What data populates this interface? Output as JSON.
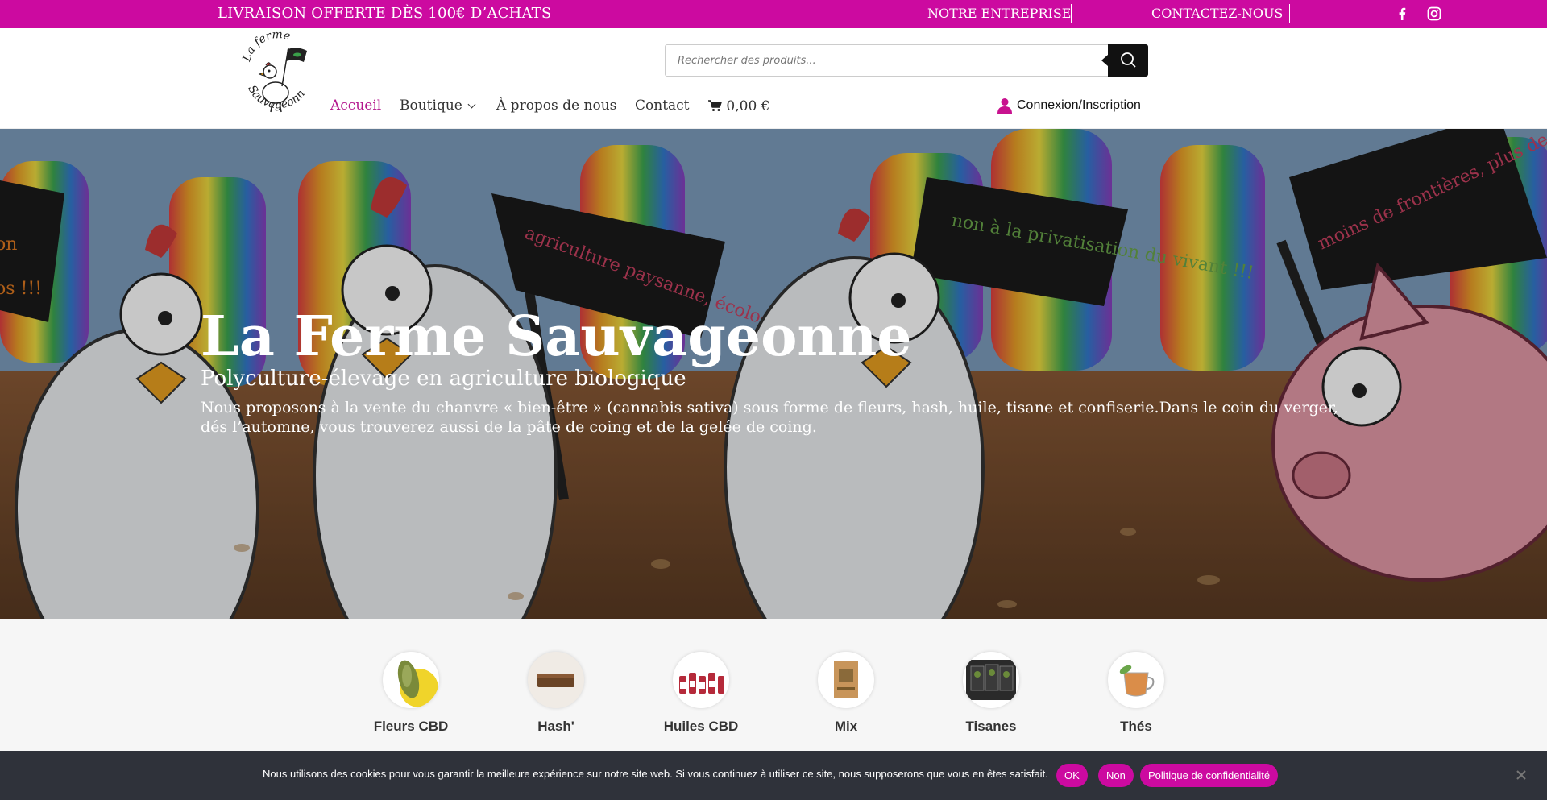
{
  "topbar": {
    "promo": "LIVRAISON OFFERTE DÈS 100€ D’ACHATS",
    "links": [
      "NOTRE ENTREPRISE",
      "CONTACTEZ-NOUS"
    ],
    "social_icons": [
      "facebook-icon",
      "instagram-icon"
    ],
    "bg_color": "#cc0aa0"
  },
  "header": {
    "logo_icon": "la-ferme-sauvageonne-logo",
    "logo_text": [
      "La ferme",
      "Sauvageonne"
    ],
    "search": {
      "placeholder": "Rechercher des produits...",
      "value": ""
    },
    "nav": {
      "home": "Accueil",
      "shop": "Boutique",
      "about": "À propos de nous",
      "contact": "Contact",
      "cart": "0,00 €"
    },
    "account_label": "Connexion/Inscription",
    "active_color": "#b3168d"
  },
  "hero": {
    "title": "La Ferme Sauvageonne",
    "subtitle": "Polyculture-élevage en agriculture biologique",
    "description": "Nous proposons à la vente du chanvre « bien-être » (cannabis sativa) sous forme de fleurs, hash, huile, tisane et confiserie.Dans le coin du verger, dés l’automne, vous trouverez aussi de la pâte de coing et de la gelée de coing.",
    "flag_texts": [
      "agriculture paysanne, écologique et solidaire",
      "non à la privatisation du vivant !!!",
      "moins de frontières, plus de cultures !!!",
      "on",
      "os !!!"
    ]
  },
  "categories": [
    {
      "name": "Fleurs CBD",
      "icon": "cbd-flower-thumb"
    },
    {
      "name": "Hash'",
      "icon": "hash-thumb"
    },
    {
      "name": "Huiles CBD",
      "icon": "cbd-oil-bottles-thumb"
    },
    {
      "name": "Mix",
      "icon": "mix-bag-thumb"
    },
    {
      "name": "Tisanes",
      "icon": "tea-packs-thumb"
    },
    {
      "name": "Thés",
      "icon": "tea-cup-thumb"
    }
  ],
  "cookie": {
    "message": "Nous utilisons des cookies pour vous garantir la meilleure expérience sur notre site web. Si vous continuez à utiliser ce site, nous supposerons que vous en êtes satisfait.",
    "ok": "OK",
    "no": "Non",
    "policy": "Politique de confidentialité"
  }
}
